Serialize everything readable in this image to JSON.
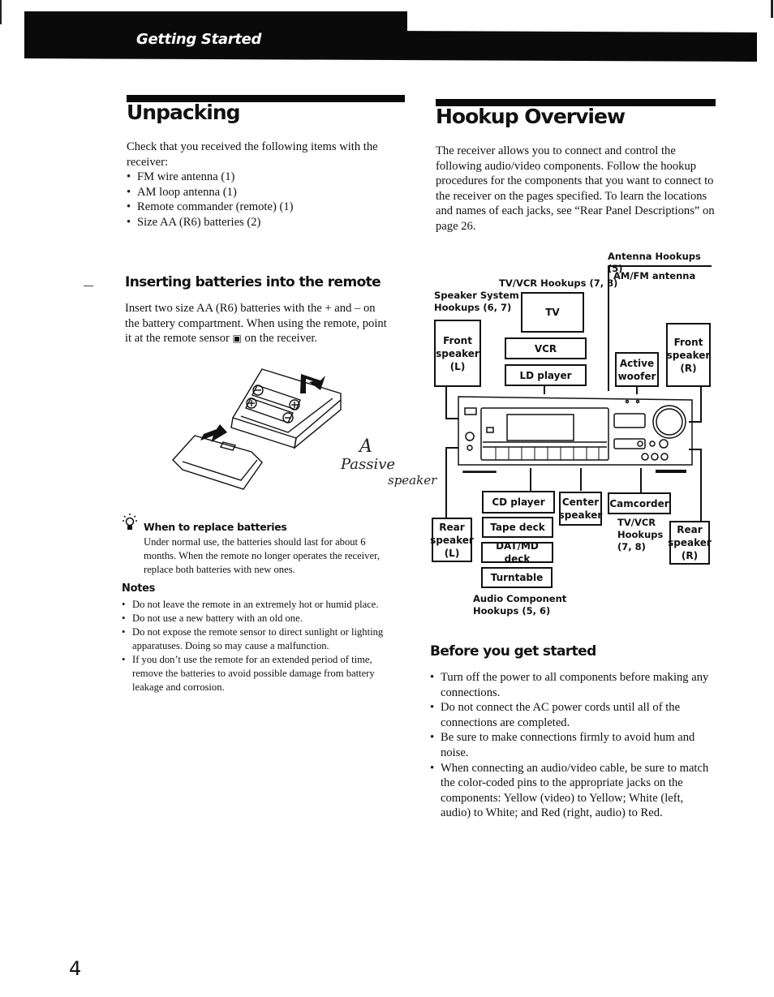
{
  "header": {
    "section_title": "Getting Started"
  },
  "unpacking": {
    "title": "Unpacking",
    "intro": "Check that you received the following items with the receiver:",
    "items": [
      "FM wire antenna  (1)",
      "AM loop antenna  (1)",
      "Remote commander (remote)  (1)",
      "Size AA (R6) batteries  (2)"
    ]
  },
  "batteries": {
    "title": "Inserting batteries into the remote",
    "text_before_icon": "Insert two size AA (R6) batteries with the + and – on the battery compartment. When using the remote, point it at the remote sensor",
    "sensor_glyph": "▣",
    "text_after_icon": "on the receiver.",
    "tip": {
      "title": "When to replace batteries",
      "text": "Under normal use, the batteries should last for about 6 months. When the remote no longer operates the receiver, replace both batteries with new ones."
    },
    "notes_title": "Notes",
    "notes": [
      "Do not leave the remote in an extremely hot or humid place.",
      "Do not use a new battery with an old one.",
      "Do not expose the remote sensor to direct sunlight or lighting apparatuses. Doing so may cause a malfunction.",
      "If you don’t use the remote for an extended period of time, remove the batteries to avoid possible damage from battery leakage and corrosion."
    ]
  },
  "handwriting": {
    "line1": "A",
    "line2": "Passive",
    "line3": "speaker"
  },
  "hookup": {
    "title": "Hookup Overview",
    "intro": "The receiver allows you to connect and control the following audio/video components.  Follow the hookup procedures for the components that you want to connect to the receiver on the pages specified.  To learn the locations and names of each jacks, see “Rear Panel Descriptions” on page 26.",
    "diagram": {
      "antenna_hookups": "Antenna Hookups (5)",
      "am_fm_antenna": "AM/FM antenna",
      "tv_vcr_hookups_top": "TV/VCR Hookups (7, 8)",
      "speaker_system_hookups": [
        "Speaker System",
        "Hookups (6, 7)"
      ],
      "tv": "TV",
      "vcr": "VCR",
      "ld_player": "LD player",
      "front_speaker_l": [
        "Front",
        "speaker",
        "(L)"
      ],
      "front_speaker_r": [
        "Front",
        "speaker",
        "(R)"
      ],
      "active_woofer": [
        "Active",
        "woofer"
      ],
      "cd_player": "CD player",
      "tape_deck": "Tape deck",
      "dat_md_deck": "DAT/MD deck",
      "turntable": "Turntable",
      "center_speaker": [
        "Center",
        "speaker"
      ],
      "camcorder": "Camcorder",
      "rear_speaker_l": [
        "Rear",
        "speaker",
        "(L)"
      ],
      "rear_speaker_r": [
        "Rear",
        "speaker",
        "(R)"
      ],
      "tv_vcr_hookups_bottom": [
        "TV/VCR",
        "Hookups",
        "(7, 8)"
      ],
      "audio_component_hookups": [
        "Audio Component",
        "Hookups (5, 6)"
      ]
    }
  },
  "before_start": {
    "title": "Before you get started",
    "items": [
      "Turn off the power to all components before making any connections.",
      "Do not connect the AC power cords until all of the connections are completed.",
      "Be sure to make connections firmly to avoid hum and noise.",
      "When connecting an audio/video cable, be sure to match the color-coded pins to the appropriate jacks on the components:  Yellow (video) to Yellow;  White (left, audio) to White;  and Red (right, audio) to Red."
    ]
  },
  "footer": {
    "page_number": "4"
  }
}
